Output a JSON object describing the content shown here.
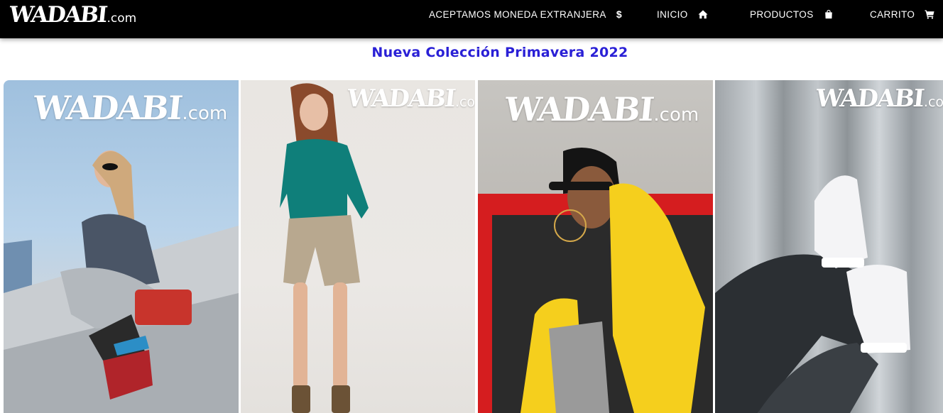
{
  "brand": {
    "name": "WADABI",
    "suffix": ".com"
  },
  "nav": {
    "currency": {
      "label": "ACEPTAMOS MONEDA EXTRANJERA",
      "icon": "dollar-icon",
      "glyph": "$"
    },
    "home": {
      "label": "INICIO",
      "icon": "home-icon"
    },
    "products": {
      "label": "PRODUCTOS",
      "icon": "shopping-bag-icon"
    },
    "cart": {
      "label": "CARRITO",
      "icon": "cart-icon"
    }
  },
  "headline": "Nueva Colección Primavera 2022",
  "colors": {
    "topbar": "#000000",
    "headline": "#2a20d6",
    "text": "#ffffff"
  },
  "gallery": [
    {
      "watermark": "WADABI",
      "watermark_suffix": ".com",
      "subject": "woman-sneakers-red-bag"
    },
    {
      "watermark": "WADABI",
      "watermark_suffix": ".com",
      "subject": "girl-teal-shirt-khaki-shorts"
    },
    {
      "watermark": "WADABI",
      "watermark_suffix": ".com",
      "subject": "woman-yellow-puffer-jacket"
    },
    {
      "watermark": "WADABI",
      "watermark_suffix": ".com",
      "subject": "white-sneakers-black-pants"
    }
  ]
}
